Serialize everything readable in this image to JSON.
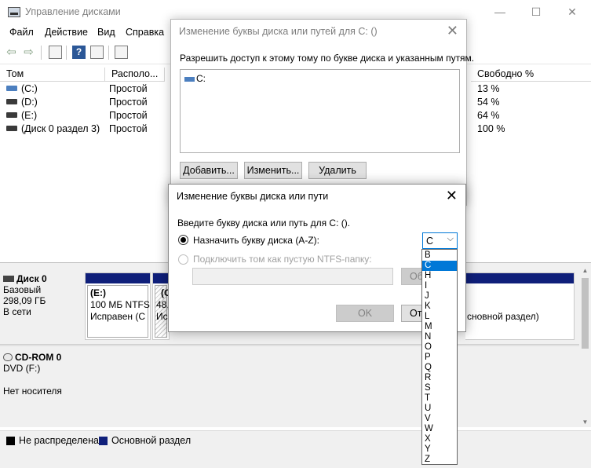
{
  "window": {
    "title": "Управление дисками",
    "minimize": "—",
    "maximize": "☐",
    "close": "✕"
  },
  "menu": [
    "Файл",
    "Действие",
    "Вид",
    "Справка"
  ],
  "toolbar": {
    "back": "⇦",
    "forward": "⇨",
    "help": "?"
  },
  "volume_list": {
    "columns": [
      "Том",
      "Располо...",
      "Свободно %"
    ],
    "rows": [
      {
        "volume": "(C:)",
        "layout": "Простой",
        "free_pct": "13 %"
      },
      {
        "volume": "(D:)",
        "layout": "Простой",
        "free_pct": "54 %"
      },
      {
        "volume": "(E:)",
        "layout": "Простой",
        "free_pct": "64 %"
      },
      {
        "volume": "(Диск 0 раздел 3)",
        "layout": "Простой",
        "free_pct": "100 %"
      }
    ]
  },
  "disks": [
    {
      "name": "Диск 0",
      "type": "Базовый",
      "size": "298,09 ГБ",
      "status": "В сети"
    },
    {
      "name": "CD-ROM 0",
      "type": "DVD (F:)",
      "size": "",
      "status": "Нет носителя"
    }
  ],
  "partitions": [
    {
      "label": "(E:)",
      "line2": "100 МБ NTFS",
      "line3": "Исправен (С"
    },
    {
      "label": "(C",
      "line2": "48,",
      "line3": "Ис"
    },
    {
      "label": "",
      "line2": "",
      "line3": "сновной раздел)"
    }
  ],
  "legend": [
    {
      "label": "Не распределена",
      "color": "#000000"
    },
    {
      "label": "Основной раздел",
      "color": "#0f1f7a"
    }
  ],
  "dialog1": {
    "title": "Изменение буквы диска или путей для C: ()",
    "close": "✕",
    "instruction": "Разрешить доступ к этому тому по букве диска и указанным путям.",
    "list_items": [
      "C:"
    ],
    "buttons": {
      "add": "Добавить...",
      "change": "Изменить...",
      "delete": "Удалить"
    }
  },
  "dialog2": {
    "title": "Изменение буквы диска или пути",
    "close": "✕",
    "prompt": "Введите букву диска или путь для C: ().",
    "option_assign": "Назначить букву диска (A-Z):",
    "option_mount": "Подключить том как пустую NTFS-папку:",
    "browse_label": "Об",
    "ok": "OK",
    "cancel": "От",
    "selected_letter": "C"
  },
  "dropdown_options": [
    "B",
    "C",
    "H",
    "I",
    "J",
    "K",
    "L",
    "M",
    "N",
    "O",
    "P",
    "Q",
    "R",
    "S",
    "T",
    "U",
    "V",
    "W",
    "X",
    "Y",
    "Z"
  ]
}
